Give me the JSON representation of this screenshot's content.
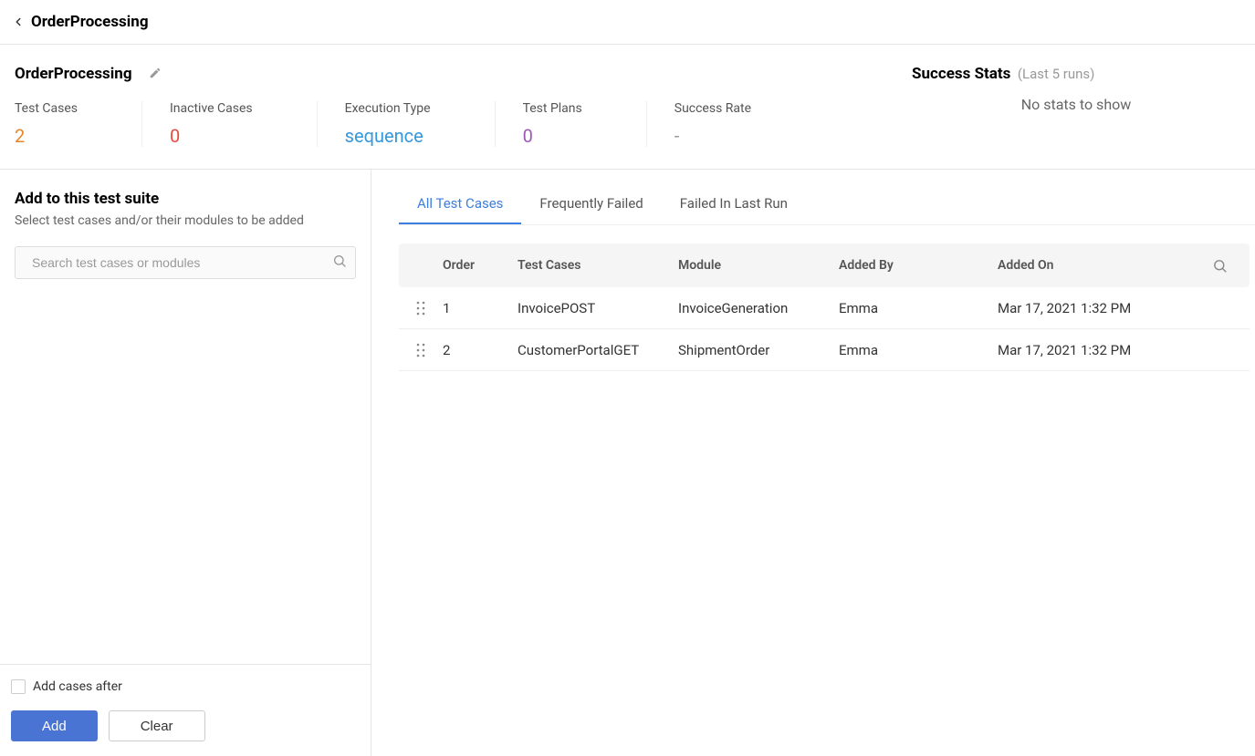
{
  "header": {
    "title": "OrderProcessing"
  },
  "suite": {
    "name": "OrderProcessing"
  },
  "stats": {
    "items": [
      {
        "label": "Test Cases",
        "value": "2",
        "cls": "stat-test-cases"
      },
      {
        "label": "Inactive Cases",
        "value": "0",
        "cls": "stat-inactive"
      },
      {
        "label": "Execution Type",
        "value": "sequence",
        "cls": "stat-execution"
      },
      {
        "label": "Test Plans",
        "value": "0",
        "cls": "stat-plans"
      },
      {
        "label": "Success Rate",
        "value": "-",
        "cls": "stat-success"
      }
    ]
  },
  "success_panel": {
    "title": "Success Stats",
    "subtitle": "(Last 5 runs)",
    "empty_text": "No stats to show"
  },
  "sidebar": {
    "title": "Add to this test suite",
    "subtitle": "Select test cases and/or their modules to be added",
    "search_placeholder": "Search test cases or modules",
    "checkbox_label": "Add cases after",
    "add_button": "Add",
    "clear_button": "Clear"
  },
  "tabs": [
    {
      "label": "All Test Cases",
      "active": true
    },
    {
      "label": "Frequently Failed",
      "active": false
    },
    {
      "label": "Failed In Last Run",
      "active": false
    }
  ],
  "table": {
    "headers": {
      "order": "Order",
      "test_cases": "Test Cases",
      "module": "Module",
      "added_by": "Added By",
      "added_on": "Added On"
    },
    "rows": [
      {
        "order": "1",
        "test_case": "InvoicePOST",
        "module": "InvoiceGeneration",
        "added_by": "Emma",
        "added_on": "Mar 17, 2021 1:32 PM"
      },
      {
        "order": "2",
        "test_case": "CustomerPortalGET",
        "module": "ShipmentOrder",
        "added_by": "Emma",
        "added_on": "Mar 17, 2021 1:32 PM"
      }
    ]
  }
}
